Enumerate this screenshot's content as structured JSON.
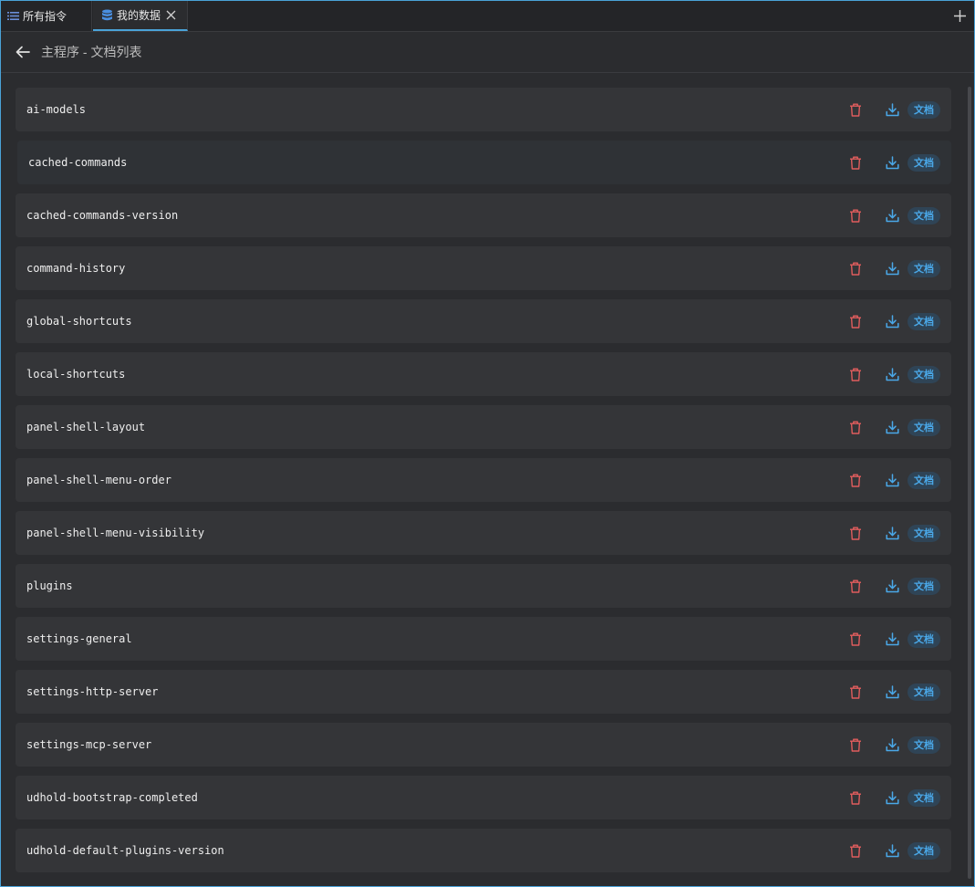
{
  "tabs": [
    {
      "label": "所有指令",
      "icon": "list-icon"
    },
    {
      "label": "我的数据",
      "icon": "database-icon",
      "active": true
    }
  ],
  "header": {
    "title": "主程序 - 文档列表"
  },
  "rows": [
    {
      "name": "ai-models",
      "badge": "文档"
    },
    {
      "name": "cached-commands",
      "badge": "文档"
    },
    {
      "name": "cached-commands-version",
      "badge": "文档"
    },
    {
      "name": "command-history",
      "badge": "文档"
    },
    {
      "name": "global-shortcuts",
      "badge": "文档"
    },
    {
      "name": "local-shortcuts",
      "badge": "文档"
    },
    {
      "name": "panel-shell-layout",
      "badge": "文档"
    },
    {
      "name": "panel-shell-menu-order",
      "badge": "文档"
    },
    {
      "name": "panel-shell-menu-visibility",
      "badge": "文档"
    },
    {
      "name": "plugins",
      "badge": "文档"
    },
    {
      "name": "settings-general",
      "badge": "文档"
    },
    {
      "name": "settings-http-server",
      "badge": "文档"
    },
    {
      "name": "settings-mcp-server",
      "badge": "文档"
    },
    {
      "name": "udhold-bootstrap-completed",
      "badge": "文档"
    },
    {
      "name": "udhold-default-plugins-version",
      "badge": "文档"
    }
  ],
  "colors": {
    "accent": "#4aa3d8",
    "delete": "#e05d5d",
    "download": "#4aa8e8"
  }
}
